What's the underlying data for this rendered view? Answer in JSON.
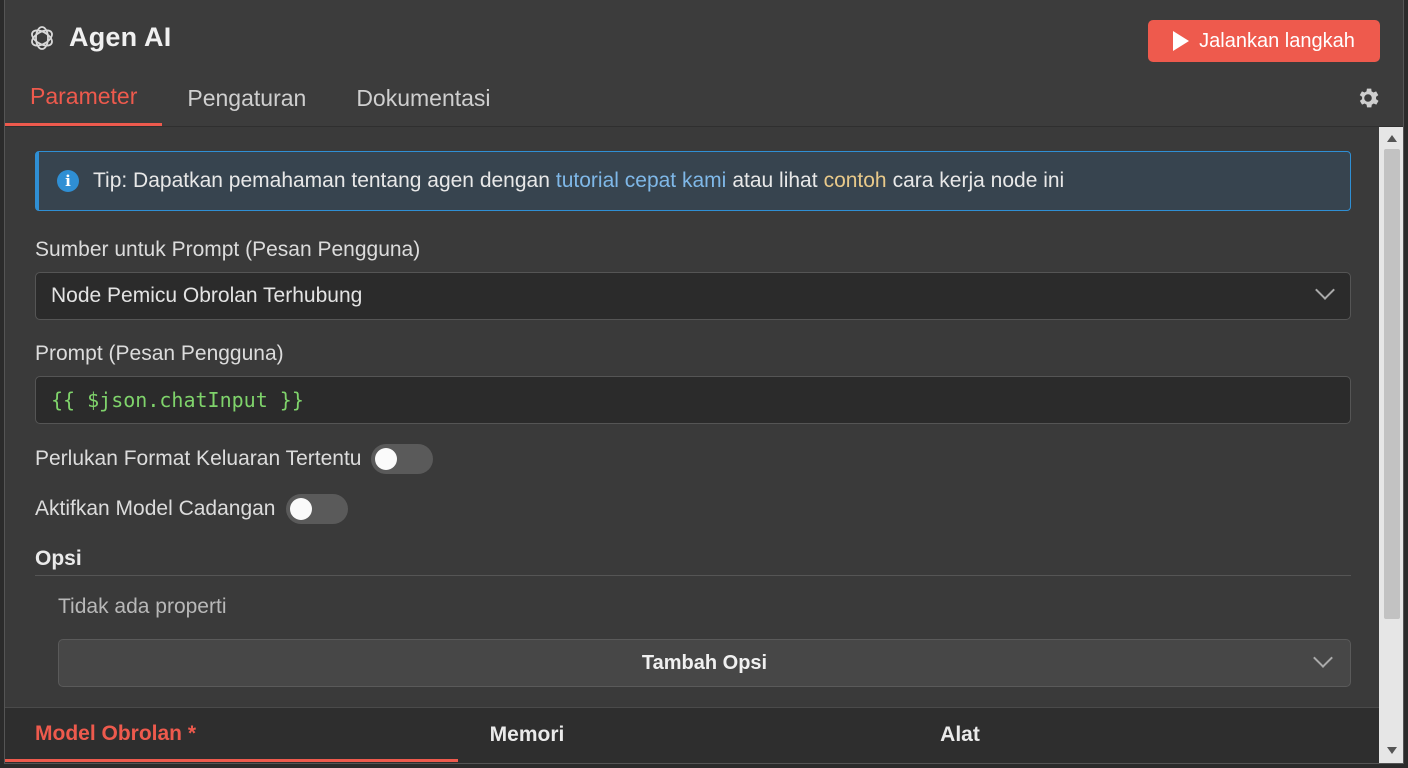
{
  "header": {
    "title": "Agen AI",
    "app_icon": "openai-knot-icon",
    "run_label": "Jalankan langkah",
    "run_icon": "play-icon",
    "settings_icon": "gear-icon"
  },
  "tabs": [
    {
      "label": "Parameter",
      "active": true
    },
    {
      "label": "Pengaturan",
      "active": false
    },
    {
      "label": "Dokumentasi",
      "active": false
    }
  ],
  "tip": {
    "icon": "info-icon",
    "text_before": "Tip: Dapatkan pemahaman tentang agen dengan",
    "link_tutorial": "tutorial cepat kami",
    "text_middle": "atau lihat",
    "link_example": "contoh",
    "text_after": "cara kerja node ini"
  },
  "prompt_source": {
    "label": "Sumber untuk Prompt (Pesan Pengguna)",
    "value": "Node Pemicu Obrolan Terhubung"
  },
  "prompt": {
    "label": "Prompt (Pesan Pengguna)",
    "value": "{{ $json.chatInput }}"
  },
  "toggles": {
    "output_format_label": "Perlukan Format Keluaran Tertentu",
    "output_format_on": false,
    "fallback_model_label": "Aktifkan Model Cadangan",
    "fallback_model_on": false
  },
  "options": {
    "title": "Opsi",
    "empty_text": "Tidak ada properti",
    "add_label": "Tambah Opsi"
  },
  "bottom_tabs": [
    {
      "label": "Model Obrolan *",
      "active": true
    },
    {
      "label": "Memori",
      "active": false
    },
    {
      "label": "Alat",
      "active": false
    }
  ],
  "colors": {
    "accent": "#ee5a4d",
    "info": "#2f8fd4",
    "code": "#7fd36b"
  }
}
